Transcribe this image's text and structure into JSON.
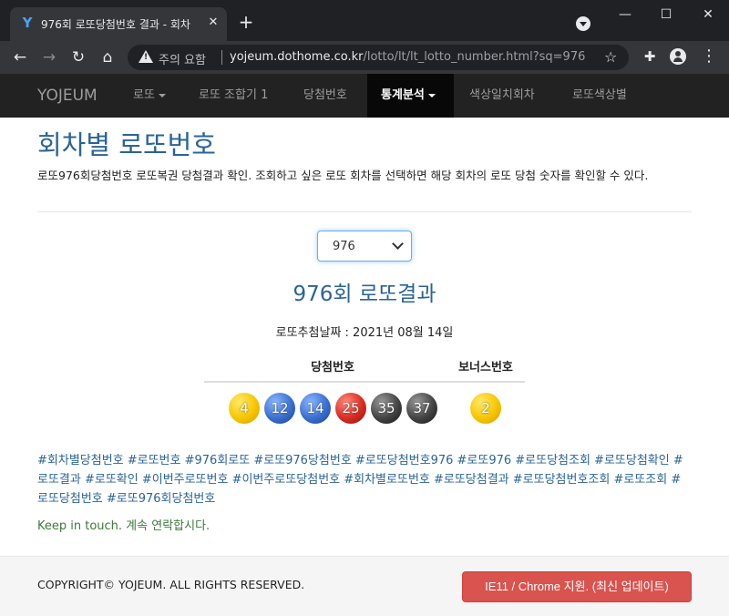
{
  "browser": {
    "tab_title": "976회 로또당첨번호 결과 - 회차",
    "tab_favicon": "Y",
    "close_glyph": "✕",
    "newtab_glyph": "+",
    "window_min": "—",
    "window_max": "☐",
    "window_close": "✕",
    "back_glyph": "←",
    "forward_glyph": "→",
    "reload_glyph": "↻",
    "home_glyph": "⌂",
    "security_warning": "주의 요함",
    "url_host": "yojeum.dothome.co.kr",
    "url_path": "/lotto/lt/lt_lotto_number.html?sq=976",
    "star_glyph": "☆",
    "ext_glyph": "✚",
    "menu_glyph": "⋮"
  },
  "navbar": {
    "brand": "YOJEUM",
    "items": [
      {
        "label": "로또",
        "dropdown": true
      },
      {
        "label": "로또 조합기 1"
      },
      {
        "label": "당첨번호"
      },
      {
        "label": "통계분석",
        "dropdown": true,
        "active": true
      },
      {
        "label": "색상일치회차"
      },
      {
        "label": "로또색상별"
      }
    ]
  },
  "main": {
    "page_title": "회차별 로또번호",
    "description": "로또976회당첨번호 로또복권 당첨결과 확인. 조회하고 싶은 로또 회차를 선택하면 해당 회차의 로또 당첨 숫자를 확인할 수 있다.",
    "selected_round": "976",
    "result_title": "976회 로또결과",
    "draw_date": "로또추첨날짜 : 2021년 08월 14일",
    "winning_header": "당첨번호",
    "bonus_header": "보너스번호",
    "winning_numbers": [
      {
        "value": "4",
        "color": "yellow"
      },
      {
        "value": "12",
        "color": "blue"
      },
      {
        "value": "14",
        "color": "blue"
      },
      {
        "value": "25",
        "color": "red"
      },
      {
        "value": "35",
        "color": "black"
      },
      {
        "value": "37",
        "color": "black"
      }
    ],
    "bonus_number": {
      "value": "2",
      "color": "yellow"
    },
    "tags": "#회차별당첨번호 #로또번호 #976회로또 #로또976당첨번호 #로또당첨번호976 #로또976 #로또당첨조회 #로또당첨확인 #로또결과 #로또확인 #이번주로또번호 #이번주로또당첨번호 #회차별로또번호 #로또당첨결과 #로또당첨번호조회 #로또조회 #로또당첨번호 #로또976회당첨번호",
    "keep_in_touch": "Keep in touch. 계속 연락합시다."
  },
  "footer": {
    "copyright": "COPYRIGHT© YOJEUM. ALL RIGHTS RESERVED.",
    "support_button": "IE11 / Chrome 지원. (최신 업데이트)"
  },
  "colors": {
    "accent": "#2a6496",
    "navbar_bg": "#222222",
    "danger": "#d9534f"
  }
}
